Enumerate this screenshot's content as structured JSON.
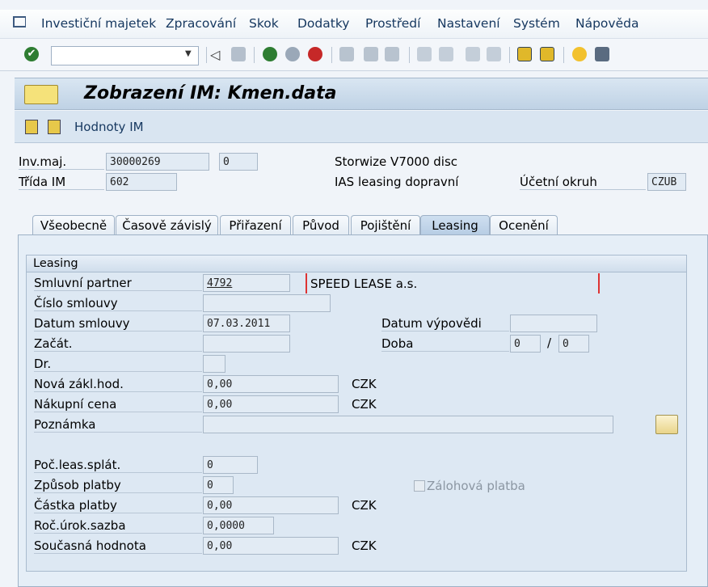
{
  "menu": {
    "items": [
      "Investiční majetek",
      "Zpracování",
      "Skok",
      "Dodatky",
      "Prostředí",
      "Nastavení",
      "Systém",
      "Nápověda"
    ]
  },
  "toolbar": {
    "command_value": ""
  },
  "title": "Zobrazení IM:  Kmen.data",
  "app_toolbar": {
    "values_button": "Hodnoty IM"
  },
  "header": {
    "asset_label": "Inv.maj.",
    "asset_number": "30000269",
    "sub_number": "0",
    "asset_description": "Storwize V7000 disc",
    "class_label": "Třída IM",
    "class_value": "602",
    "class_description": "IAS leasing dopravní",
    "company_label": "Účetní okruh",
    "company_code": "CZUB"
  },
  "tabs": [
    "Všeobecně",
    "Časově závislý",
    "Přiřazení",
    "Původ",
    "Pojištění",
    "Leasing",
    "Ocenění"
  ],
  "active_tab": "Leasing",
  "group": {
    "title": "Leasing",
    "fields": {
      "partner": {
        "label": "Smluvní partner",
        "value": "4792",
        "name": "SPEED LEASE a.s."
      },
      "contract_no": {
        "label": "Číslo smlouvy",
        "value": ""
      },
      "contract_date": {
        "label": "Datum smlouvy",
        "value": "07.03.2011"
      },
      "notice_date": {
        "label": "Datum výpovědi",
        "value": ""
      },
      "start": {
        "label": "Začát.",
        "value": ""
      },
      "duration": {
        "label": "Doba",
        "value1": "0",
        "sep": "/",
        "value2": "0"
      },
      "type": {
        "label": "Dr.",
        "value": ""
      },
      "new_base": {
        "label": "Nová zákl.hod.",
        "value": "0,00",
        "currency": "CZK"
      },
      "purchase_price": {
        "label": "Nákupní cena",
        "value": "0,00",
        "currency": "CZK"
      },
      "note": {
        "label": "Poznámka",
        "value": ""
      },
      "num_payments": {
        "label": "Poč.leas.splát.",
        "value": "0"
      },
      "payment_method": {
        "label": "Způsob platby",
        "value": "0"
      },
      "advance_payment": {
        "label": "Zálohová platba",
        "checked": false
      },
      "payment_amount": {
        "label": "Částka platby",
        "value": "0,00",
        "currency": "CZK"
      },
      "interest_rate": {
        "label": "Roč.úrok.sazba",
        "value": "0,0000"
      },
      "present_value": {
        "label": "Současná hodnota",
        "value": "0,00",
        "currency": "CZK"
      }
    }
  }
}
